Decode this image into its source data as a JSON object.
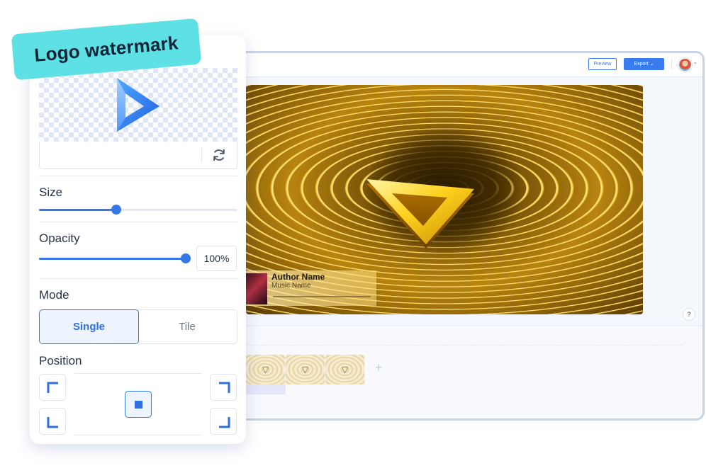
{
  "badge": {
    "label": "Logo watermark"
  },
  "editor": {
    "topbar": {
      "preview_label": "Preview",
      "export_label": "Export",
      "export_icon": "chevron-down-icon",
      "avatar_icon": "user-avatar"
    },
    "music_card": {
      "author": "Author Name",
      "title": "Music Name"
    },
    "help_label": "?",
    "add_clip_label": "+"
  },
  "panel": {
    "refresh_icon": "refresh-icon",
    "size": {
      "label": "Size",
      "value_fraction": 0.39
    },
    "opacity": {
      "label": "Opacity",
      "value": "100%",
      "value_fraction": 1.0
    },
    "mode": {
      "label": "Mode",
      "options": [
        "Single",
        "Tile"
      ],
      "selected": "Single"
    },
    "position": {
      "label": "Position",
      "selected": "center"
    }
  },
  "colors": {
    "accent": "#3577e6",
    "badge": "#5ee1e4",
    "canvas_gold": "#ffd23c"
  }
}
